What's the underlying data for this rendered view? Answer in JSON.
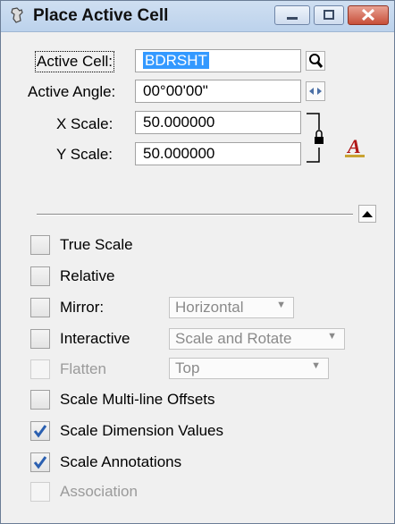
{
  "window": {
    "title": "Place Active Cell"
  },
  "fields": {
    "active_cell": {
      "label": "Active Cell:",
      "value": "BDRSHT"
    },
    "active_angle": {
      "label": "Active Angle:",
      "value": "00°00'00\""
    },
    "x_scale": {
      "label": "X Scale:",
      "value": "50.000000"
    },
    "y_scale": {
      "label": "Y Scale:",
      "value": "50.000000"
    }
  },
  "options": {
    "true_scale": {
      "label": "True Scale",
      "checked": false
    },
    "relative": {
      "label": "Relative",
      "checked": false
    },
    "mirror": {
      "label": "Mirror:",
      "checked": false,
      "value": "Horizontal"
    },
    "interactive": {
      "label": "Interactive",
      "checked": false,
      "value": "Scale and Rotate"
    },
    "flatten": {
      "label": "Flatten",
      "checked": false,
      "enabled": false,
      "value": "Top"
    },
    "scale_multiline": {
      "label": "Scale Multi-line Offsets",
      "checked": false
    },
    "scale_dimension": {
      "label": "Scale Dimension Values",
      "checked": true
    },
    "scale_annotations": {
      "label": "Scale Annotations",
      "checked": true
    },
    "association": {
      "label": "Association",
      "checked": false,
      "enabled": false
    }
  },
  "colors": {
    "selection": "#3399ff",
    "check": "#2a5fb0"
  },
  "icons": [
    "cell-tool-icon",
    "magnifier-icon",
    "spin-arrows-icon",
    "lock-icon",
    "text-style-icon",
    "collapse-arrow-icon"
  ]
}
